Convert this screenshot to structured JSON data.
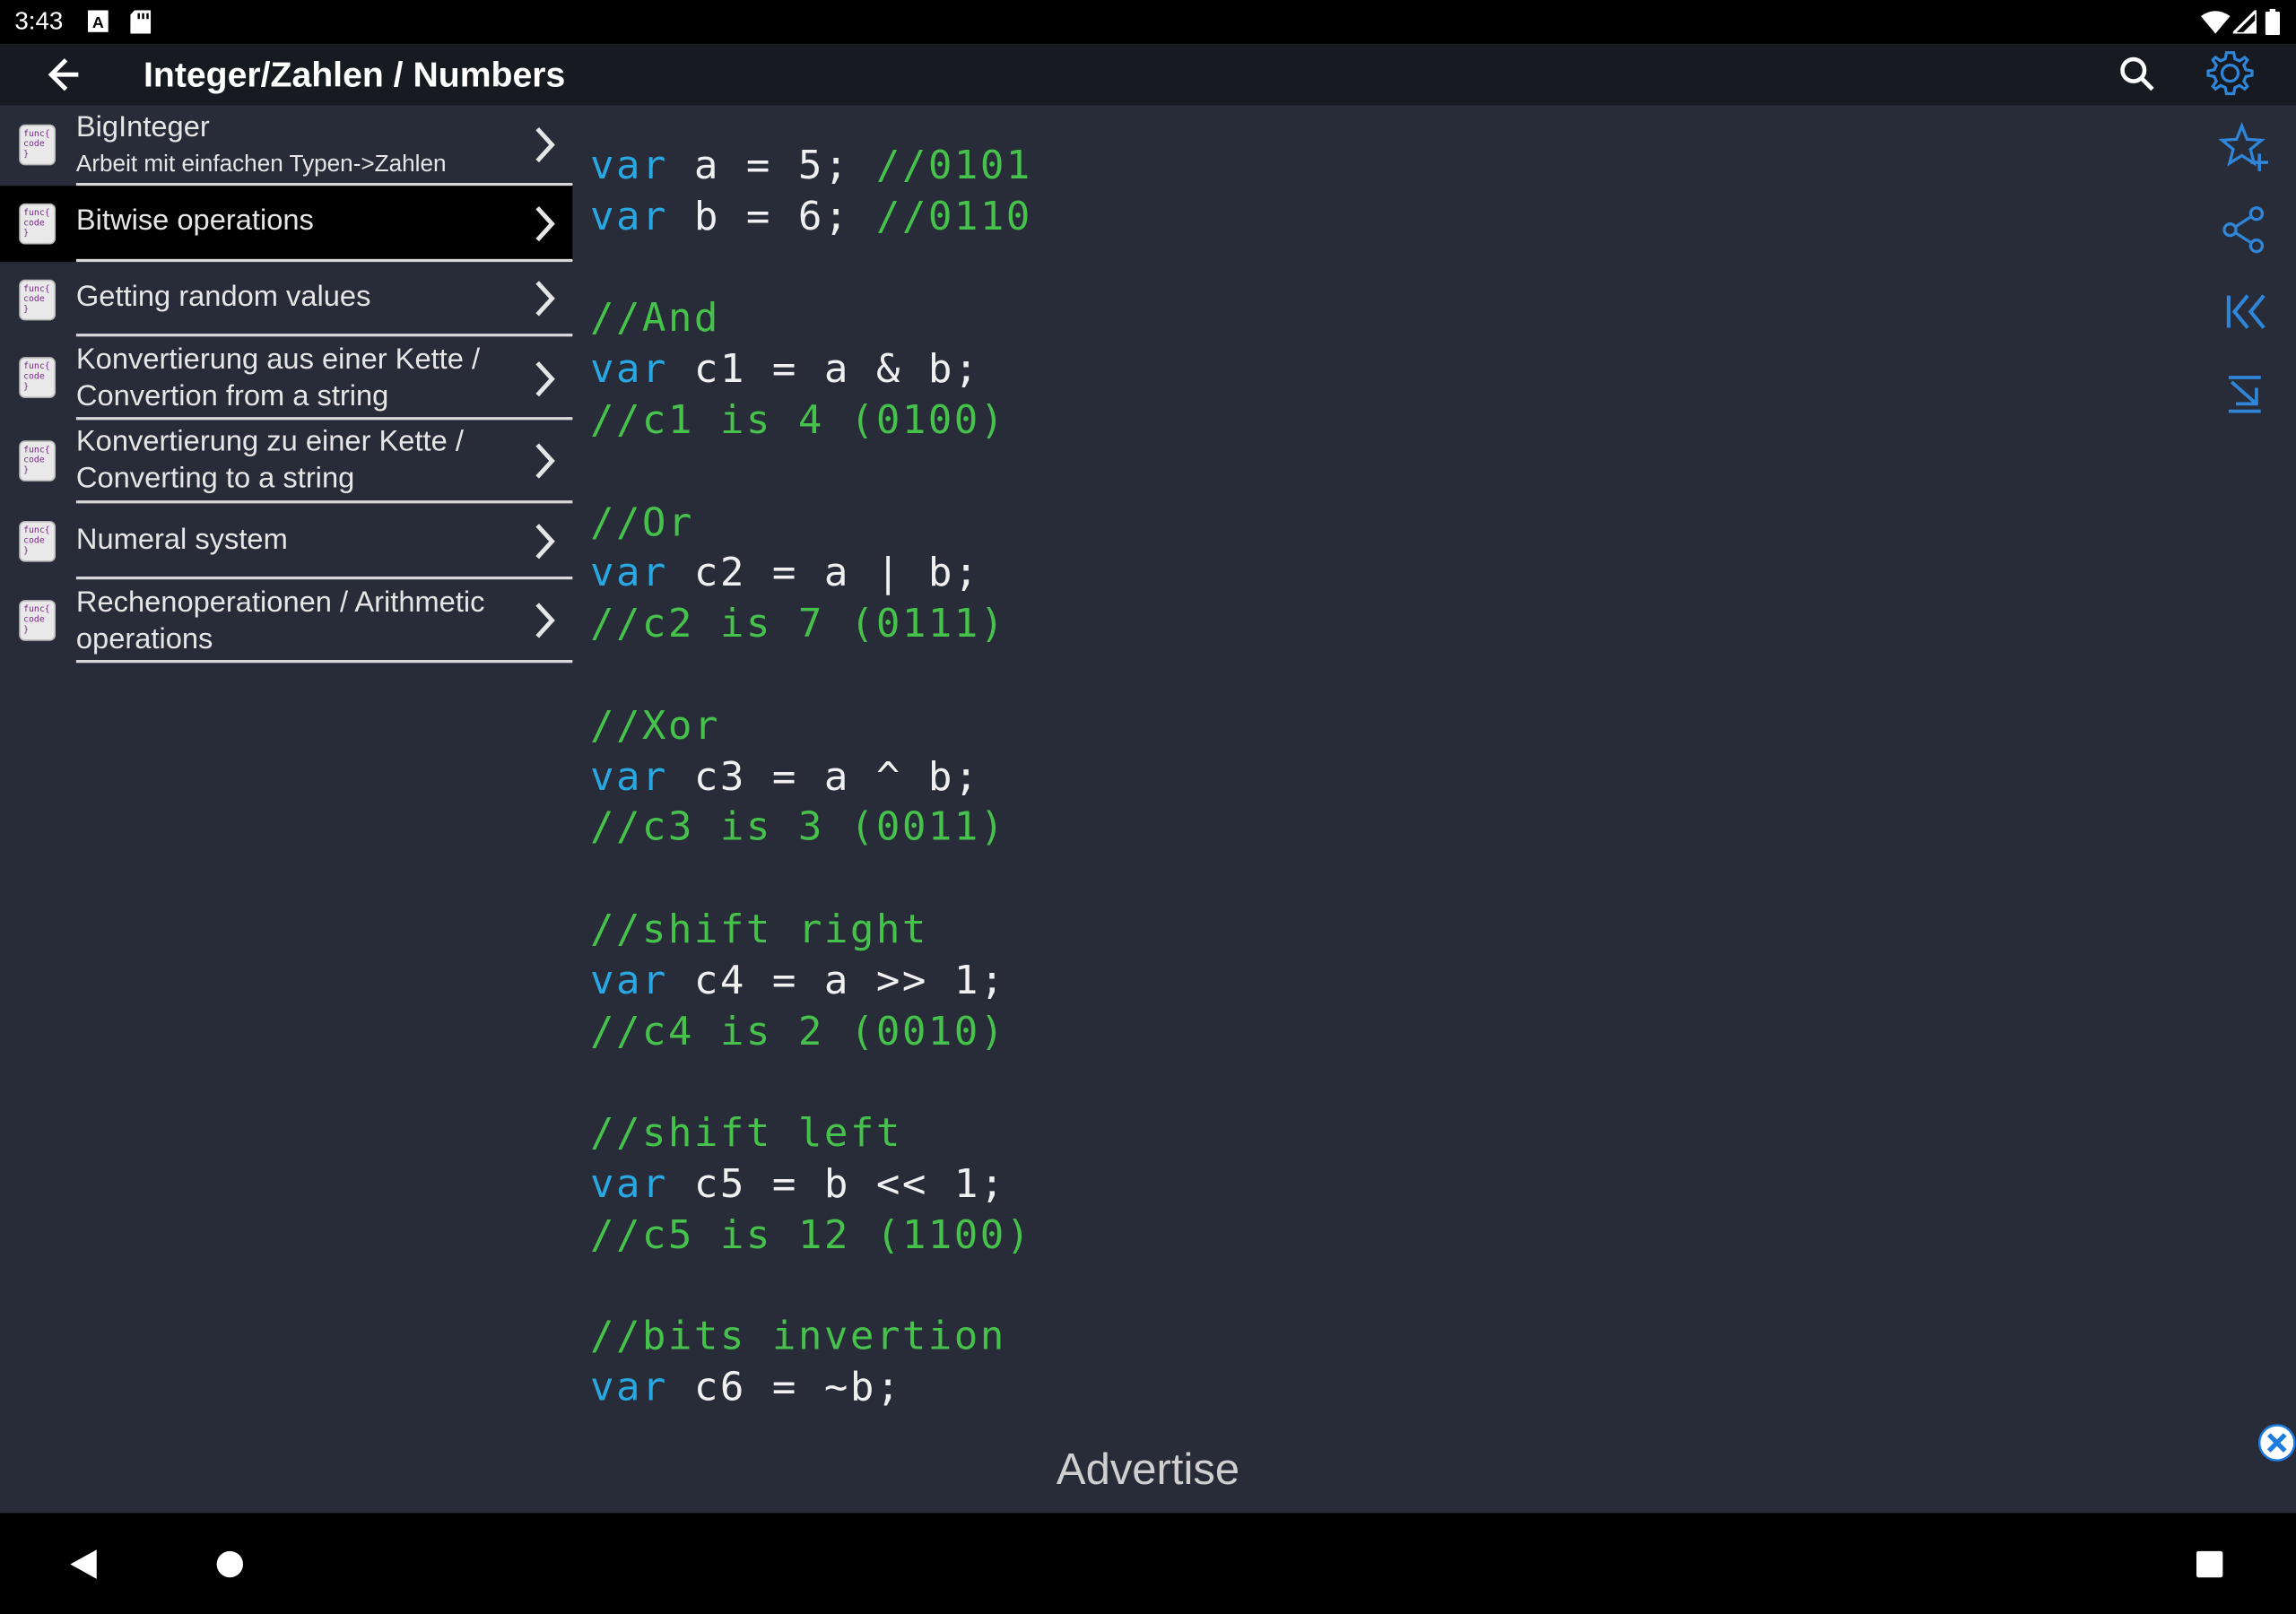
{
  "status_bar": {
    "time": "3:43",
    "icons": [
      "a-notification-icon",
      "sd-card-icon",
      "wifi-icon",
      "signal-icon",
      "battery-icon"
    ]
  },
  "app_bar": {
    "title": "Integer/Zahlen / Numbers",
    "icons": [
      "back-arrow-icon",
      "search-icon",
      "gear-icon"
    ],
    "accent_color": "#2f86d8"
  },
  "list": {
    "items": [
      {
        "label": "BigInteger",
        "subtitle": "Arbeit mit einfachen Typen->Zahlen",
        "selected": false
      },
      {
        "label": "Bitwise operations",
        "subtitle": "",
        "selected": true
      },
      {
        "label": "Getting random values",
        "subtitle": "",
        "selected": false
      },
      {
        "label": "Konvertierung aus einer Kette /",
        "label2": "Convertion from a string",
        "selected": false
      },
      {
        "label": "Konvertierung zu einer Kette /",
        "label2": "Converting to a string",
        "selected": false
      },
      {
        "label": "Numeral system",
        "subtitle": "",
        "selected": false
      },
      {
        "label": "Rechenoperationen / Arithmetic",
        "label2": "operations",
        "selected": false
      }
    ],
    "item_icon_text": [
      "func{",
      "code",
      "}"
    ]
  },
  "code": {
    "lines": [
      [
        {
          "t": "var",
          "c": "kw"
        },
        {
          "t": " a = 5; ",
          "c": "tx"
        },
        {
          "t": "//0101",
          "c": "cm"
        }
      ],
      [
        {
          "t": "var",
          "c": "kw"
        },
        {
          "t": " b = 6; ",
          "c": "tx"
        },
        {
          "t": "//0110",
          "c": "cm"
        }
      ],
      [],
      [
        {
          "t": "//And",
          "c": "cm"
        }
      ],
      [
        {
          "t": "var",
          "c": "kw"
        },
        {
          "t": " c1 = a & b;",
          "c": "tx"
        }
      ],
      [
        {
          "t": "//c1 is 4 (0100)",
          "c": "cm"
        }
      ],
      [],
      [
        {
          "t": "//Or",
          "c": "cm"
        }
      ],
      [
        {
          "t": "var",
          "c": "kw"
        },
        {
          "t": " c2 = a | b;",
          "c": "tx"
        }
      ],
      [
        {
          "t": "//c2 is 7 (0111)",
          "c": "cm"
        }
      ],
      [],
      [
        {
          "t": "//Xor",
          "c": "cm"
        }
      ],
      [
        {
          "t": "var",
          "c": "kw"
        },
        {
          "t": " c3 = a ^ b;",
          "c": "tx"
        }
      ],
      [
        {
          "t": "//c3 is 3 (0011)",
          "c": "cm"
        }
      ],
      [],
      [
        {
          "t": "//shift right",
          "c": "cm"
        }
      ],
      [
        {
          "t": "var",
          "c": "kw"
        },
        {
          "t": " c4 = a >> 1;",
          "c": "tx"
        }
      ],
      [
        {
          "t": "//c4 is 2 (0010)",
          "c": "cm"
        }
      ],
      [],
      [
        {
          "t": "//shift left",
          "c": "cm"
        }
      ],
      [
        {
          "t": "var",
          "c": "kw"
        },
        {
          "t": " c5 = b << 1;",
          "c": "tx"
        }
      ],
      [
        {
          "t": "//c5 is 12 (1100)",
          "c": "cm"
        }
      ],
      [],
      [
        {
          "t": "//bits invertion",
          "c": "cm"
        }
      ],
      [
        {
          "t": "var",
          "c": "kw"
        },
        {
          "t": " c6 = ~b;",
          "c": "tx"
        }
      ]
    ],
    "colors": {
      "keyword": "#2aa6e0",
      "comment": "#46c14b",
      "text": "#f0f0f0"
    }
  },
  "right_toolbar": {
    "icons": [
      "star-add-icon",
      "share-icon",
      "first-page-icon",
      "scroll-down-icon"
    ]
  },
  "ad": {
    "text": "Advertise",
    "close_icon": "close-circle-icon"
  },
  "nav_bar": {
    "icons": [
      "nav-back-icon",
      "nav-home-icon",
      "nav-recents-icon"
    ]
  }
}
